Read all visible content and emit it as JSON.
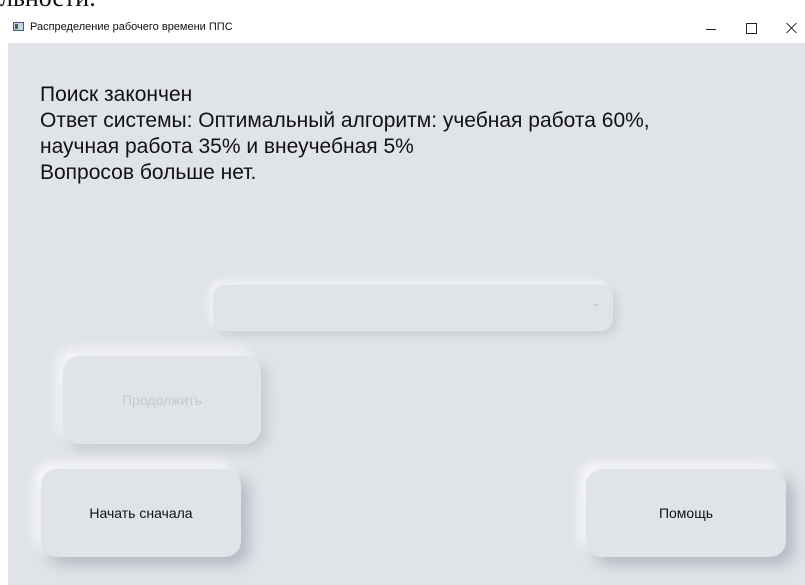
{
  "background_text": "льности.",
  "window": {
    "title": "Распределение рабочего времени ППС",
    "controls": {
      "minimize": "minimize",
      "maximize": "maximize",
      "close": "close"
    }
  },
  "message": {
    "line1": "Поиск закончен",
    "line2": "Ответ системы: Оптимальный алгоритм:  учебная работа 60%,",
    "line3": "научная работа 35% и внеучебная 5%",
    "line4": "Вопросов больше нет."
  },
  "answer_combo": {
    "selected": ""
  },
  "buttons": {
    "continue": "Продолжить",
    "restart": "Начать сначала",
    "help": "Помощь"
  },
  "colors": {
    "window_bg": "#e0e3e8",
    "disabled_text": "#c6c9ce"
  }
}
